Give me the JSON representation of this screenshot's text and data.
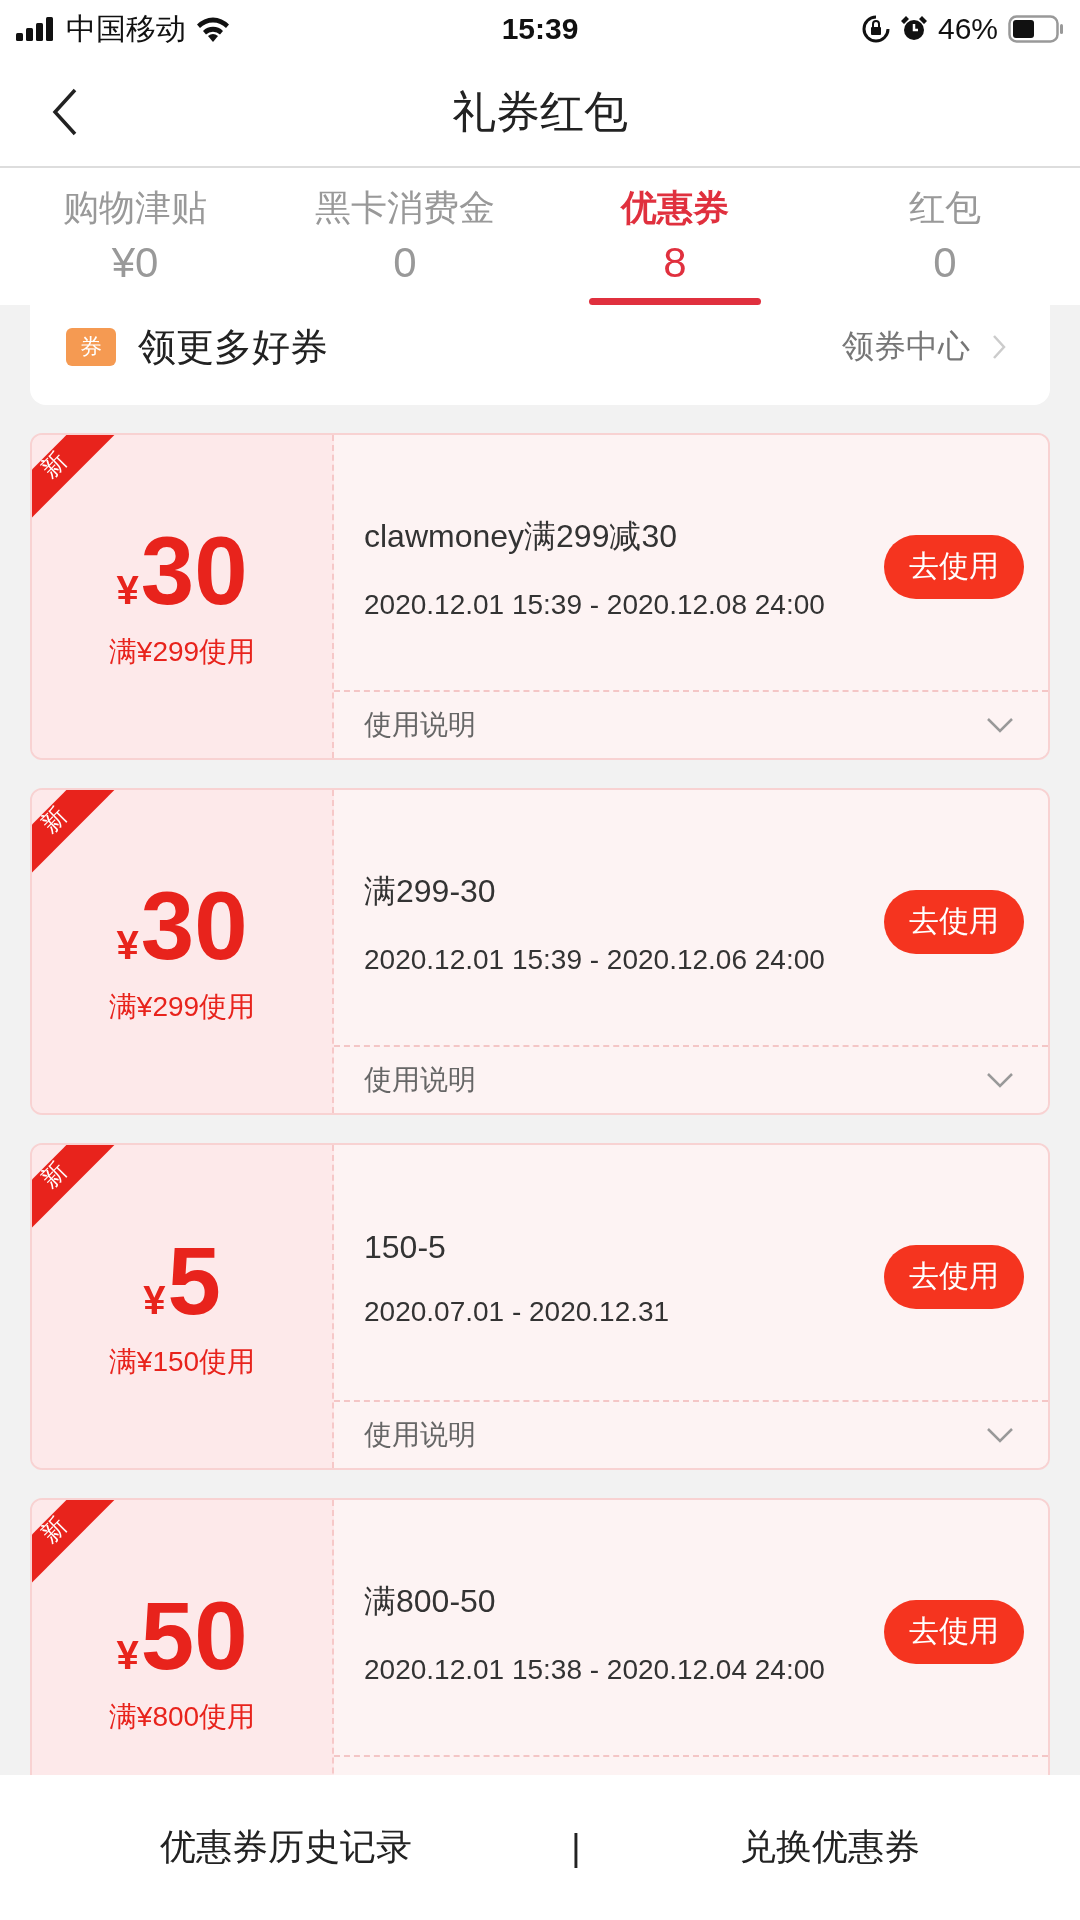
{
  "status_bar": {
    "carrier": "中国移动",
    "time": "15:39",
    "battery": "46%"
  },
  "nav": {
    "title": "礼券红包"
  },
  "tabs": [
    {
      "label": "购物津贴",
      "value": "¥0",
      "selected": false
    },
    {
      "label": "黑卡消费金",
      "value": "0",
      "selected": false
    },
    {
      "label": "优惠券",
      "value": "8",
      "selected": true
    },
    {
      "label": "红包",
      "value": "0",
      "selected": false
    }
  ],
  "banner": {
    "icon_text": "券",
    "title": "领更多好券",
    "link": "领券中心"
  },
  "coupons": [
    {
      "badge": "新",
      "currency": "¥",
      "amount": "30",
      "condition": "满¥299使用",
      "title": "clawmoney满299减30",
      "validity": "2020.12.01 15:39 - 2020.12.08 24:00",
      "button": "去使用",
      "instructions": "使用说明"
    },
    {
      "badge": "新",
      "currency": "¥",
      "amount": "30",
      "condition": "满¥299使用",
      "title": "满299-30",
      "validity": "2020.12.01 15:39 - 2020.12.06 24:00",
      "button": "去使用",
      "instructions": "使用说明"
    },
    {
      "badge": "新",
      "currency": "¥",
      "amount": "5",
      "condition": "满¥150使用",
      "title": "150-5",
      "validity": "2020.07.01 - 2020.12.31",
      "button": "去使用",
      "instructions": "使用说明"
    },
    {
      "badge": "新",
      "currency": "¥",
      "amount": "50",
      "condition": "满¥800使用",
      "title": "满800-50",
      "validity": "2020.12.01 15:38 - 2020.12.04 24:00",
      "button": "去使用"
    }
  ],
  "bottom_bar": {
    "left": "优惠券历史记录",
    "separator": "|",
    "right": "兑换优惠券"
  }
}
